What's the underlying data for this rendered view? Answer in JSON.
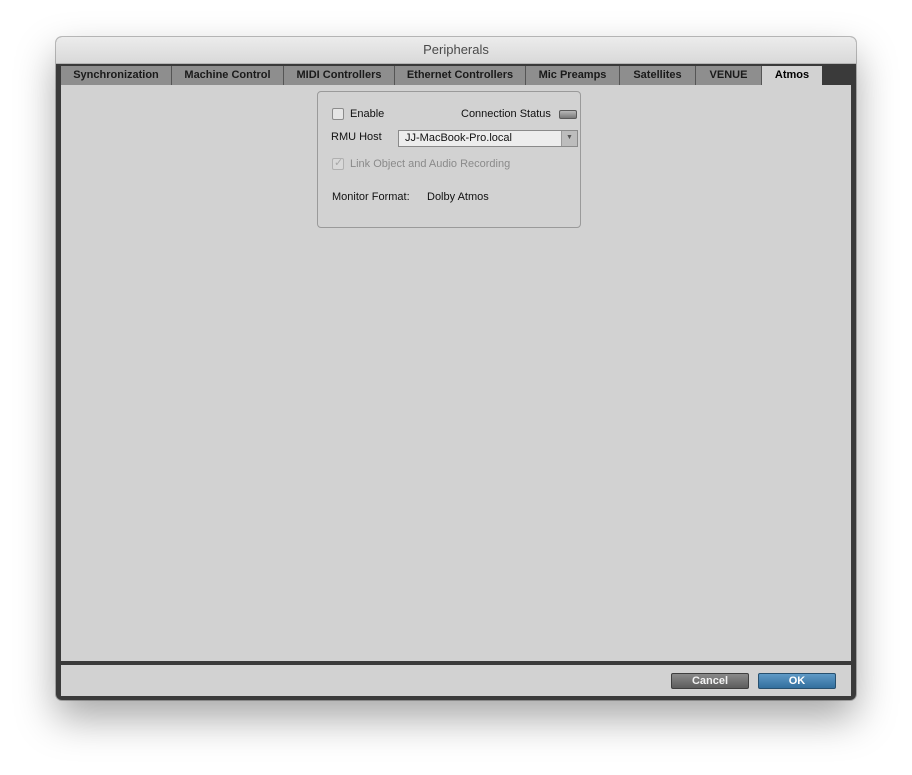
{
  "window": {
    "title": "Peripherals"
  },
  "tabs": [
    {
      "label": "Synchronization"
    },
    {
      "label": "Machine Control"
    },
    {
      "label": "MIDI Controllers"
    },
    {
      "label": "Ethernet Controllers"
    },
    {
      "label": "Mic Preamps"
    },
    {
      "label": "Satellites"
    },
    {
      "label": "VENUE"
    },
    {
      "label": "Atmos"
    }
  ],
  "active_tab": "Atmos",
  "atmos": {
    "enable_label": "Enable",
    "enable_checked": false,
    "connection_status_label": "Connection Status",
    "rmu_host_label": "RMU Host",
    "rmu_host_value": "JJ-MacBook-Pro.local",
    "link_label": "Link Object and Audio Recording",
    "link_checked": true,
    "link_enabled": false,
    "monitor_format_label": "Monitor Format:",
    "monitor_format_value": "Dolby Atmos"
  },
  "footer": {
    "cancel_label": "Cancel",
    "ok_label": "OK"
  },
  "colors": {
    "ok_button": "#3d7aa8",
    "panel_bg": "#d2d2d2",
    "tab_inactive": "#8e8e8e"
  },
  "icons": {
    "select_arrow": "triangle-down-icon",
    "status": "status-led-icon",
    "check": "checkmark-icon"
  }
}
